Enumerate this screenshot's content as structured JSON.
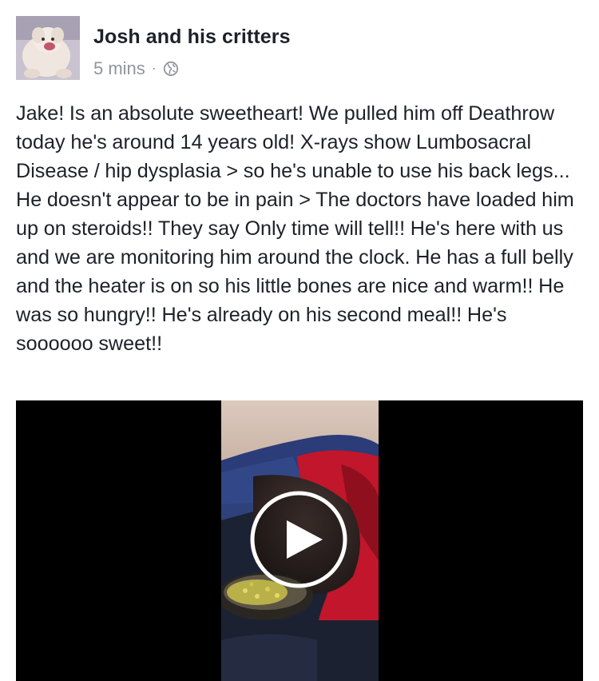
{
  "post": {
    "author": "Josh and his critters",
    "timestamp": "5 mins",
    "separator": "·",
    "privacy_icon": "globe-icon",
    "text": "Jake! Is an absolute sweetheart! We pulled him off Deathrow today he's around 14 years old! X-rays show Lumbosacral Disease / hip dysplasia > so he's unable to use his back legs... He doesn't appear to be in pain > The doctors have loaded him up on steroids!! They say Only time will tell!! He's here with us and we are monitoring him around the clock. He has a full belly and the heater is on so his little bones are nice and warm!! He was so hungry!! He's already on his second meal!! He's soooooo sweet!!",
    "video": {
      "play_icon": "play-icon"
    }
  },
  "colors": {
    "author_text": "#1d2129",
    "meta_text": "#90949c",
    "video_background": "#000000",
    "play_ring": "#ffffff"
  }
}
